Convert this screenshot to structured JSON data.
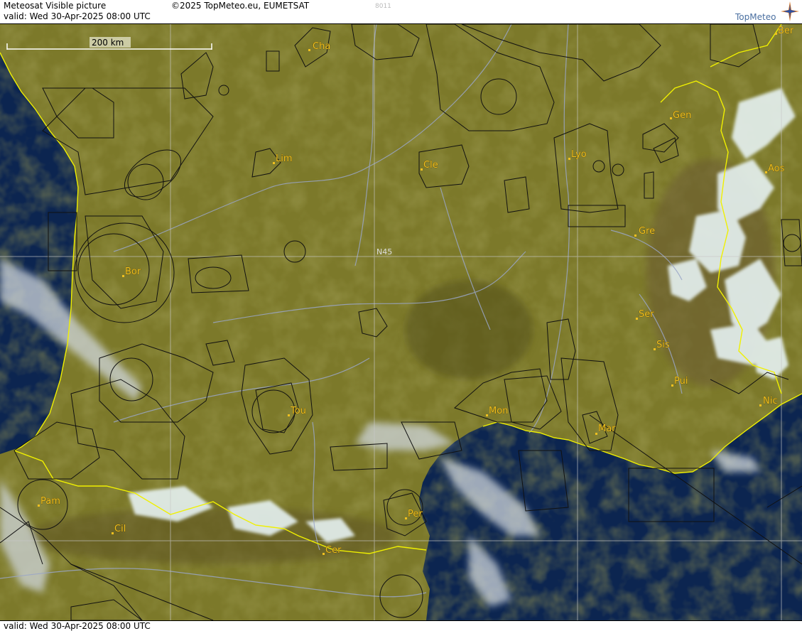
{
  "header": {
    "product": "Meteosat Visible picture",
    "valid": "valid:  Wed  30-Apr-2025  08:00 UTC",
    "copyright": "©2025 TopMeteo.eu, EUMETSAT",
    "code": "8011",
    "logo": "TopMeteo"
  },
  "footer": {
    "valid": "valid:  Wed  30-Apr-2025  08:00 UTC"
  },
  "map": {
    "scale_label": "200 km",
    "grid_label": "N45",
    "cities": [
      {
        "key": "cha",
        "name": "Cha"
      },
      {
        "key": "ber",
        "name": "Ber"
      },
      {
        "key": "gen",
        "name": "Gen"
      },
      {
        "key": "lim",
        "name": "Lim"
      },
      {
        "key": "cle",
        "name": "Cle"
      },
      {
        "key": "lyo",
        "name": "Lyo"
      },
      {
        "key": "aos",
        "name": "Aos"
      },
      {
        "key": "gre",
        "name": "Gre"
      },
      {
        "key": "bor",
        "name": "Bor"
      },
      {
        "key": "ser",
        "name": "Ser"
      },
      {
        "key": "sis",
        "name": "Sis"
      },
      {
        "key": "pui",
        "name": "Pui"
      },
      {
        "key": "tou",
        "name": "Tou"
      },
      {
        "key": "mon",
        "name": "Mon"
      },
      {
        "key": "mar",
        "name": "Mar"
      },
      {
        "key": "nic",
        "name": "Nic"
      },
      {
        "key": "pam",
        "name": "Pam"
      },
      {
        "key": "cil",
        "name": "Cil"
      },
      {
        "key": "per",
        "name": "Per"
      },
      {
        "key": "cer",
        "name": "Cer"
      }
    ],
    "colors": {
      "land": "#7d7a2a",
      "land_dark": "#5e5a1e",
      "sea": "#0f2a55",
      "sea_deep": "#0a1f45",
      "snow": "#e8f4f4",
      "border": "#f0f000",
      "river": "#9aa6c8",
      "airspace": "#000000",
      "grid": "#c8c8c8",
      "label": "#f0c020"
    }
  }
}
